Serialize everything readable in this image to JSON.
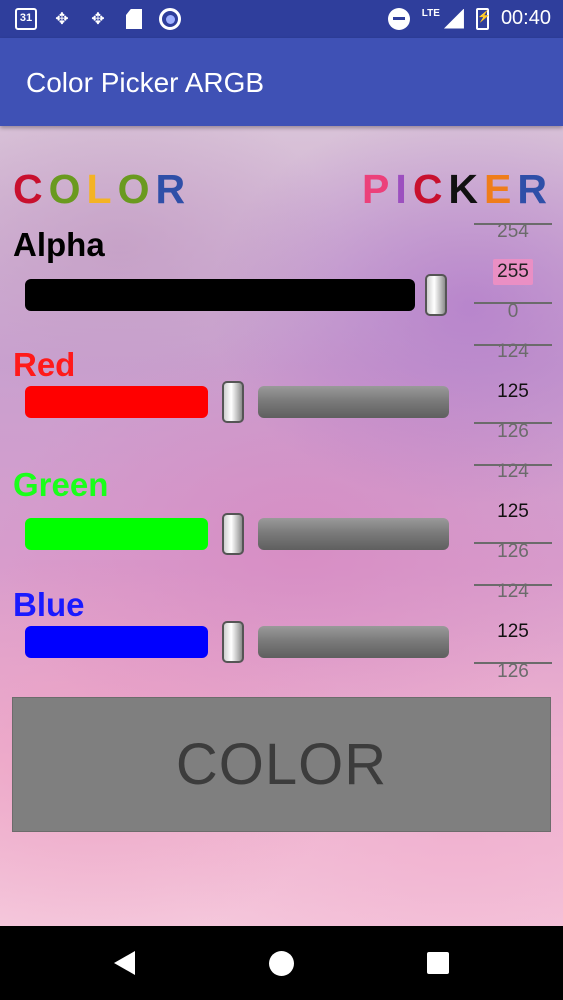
{
  "status_bar": {
    "calendar_day": "31",
    "network_type": "LTE",
    "time": "00:40",
    "left_icons": [
      "calendar-icon",
      "pinwheel-icon",
      "pinwheel-icon",
      "sd-card-icon",
      "circle-app-icon"
    ],
    "right_icons": [
      "do-not-disturb-icon",
      "signal-icon",
      "battery-charging-icon"
    ]
  },
  "app_bar": {
    "title": "Color Picker ARGB"
  },
  "title_word_left": [
    {
      "char": "C",
      "color": "#c8102e"
    },
    {
      "char": "O",
      "color": "#6a9a1f"
    },
    {
      "char": "L",
      "color": "#f4b324"
    },
    {
      "char": "O",
      "color": "#6a9a1f"
    },
    {
      "char": "R",
      "color": "#2f4fa8"
    }
  ],
  "title_word_right": [
    {
      "char": "P",
      "color": "#ec407a"
    },
    {
      "char": "I",
      "color": "#9c4fbf"
    },
    {
      "char": "C",
      "color": "#c8102e"
    },
    {
      "char": "K",
      "color": "#111111"
    },
    {
      "char": "E",
      "color": "#ef7d1a"
    },
    {
      "char": "R",
      "color": "#2f4fa8"
    }
  ],
  "channels": {
    "alpha": {
      "label": "Alpha",
      "label_color": "#000000",
      "fill_color": "#000000",
      "value_fraction": 1.0,
      "picker": {
        "prev": "254",
        "current": "255",
        "next": "0"
      }
    },
    "red": {
      "label": "Red",
      "label_color": "#ff1a1a",
      "fill_color": "#ff0000",
      "value_fraction": 0.49,
      "picker": {
        "prev": "124",
        "current": "125",
        "next": "126"
      }
    },
    "green": {
      "label": "Green",
      "label_color": "#1aff1a",
      "fill_color": "#00ff00",
      "value_fraction": 0.49,
      "picker": {
        "prev": "124",
        "current": "125",
        "next": "126"
      }
    },
    "blue": {
      "label": "Blue",
      "label_color": "#1a1aff",
      "fill_color": "#0000ff",
      "value_fraction": 0.49,
      "picker": {
        "prev": "124",
        "current": "125",
        "next": "126"
      }
    }
  },
  "color_preview": {
    "label": "COLOR",
    "background": "#7f7f7f"
  },
  "nav_bar": {
    "icons": [
      "back-icon",
      "home-icon",
      "recents-icon"
    ]
  }
}
